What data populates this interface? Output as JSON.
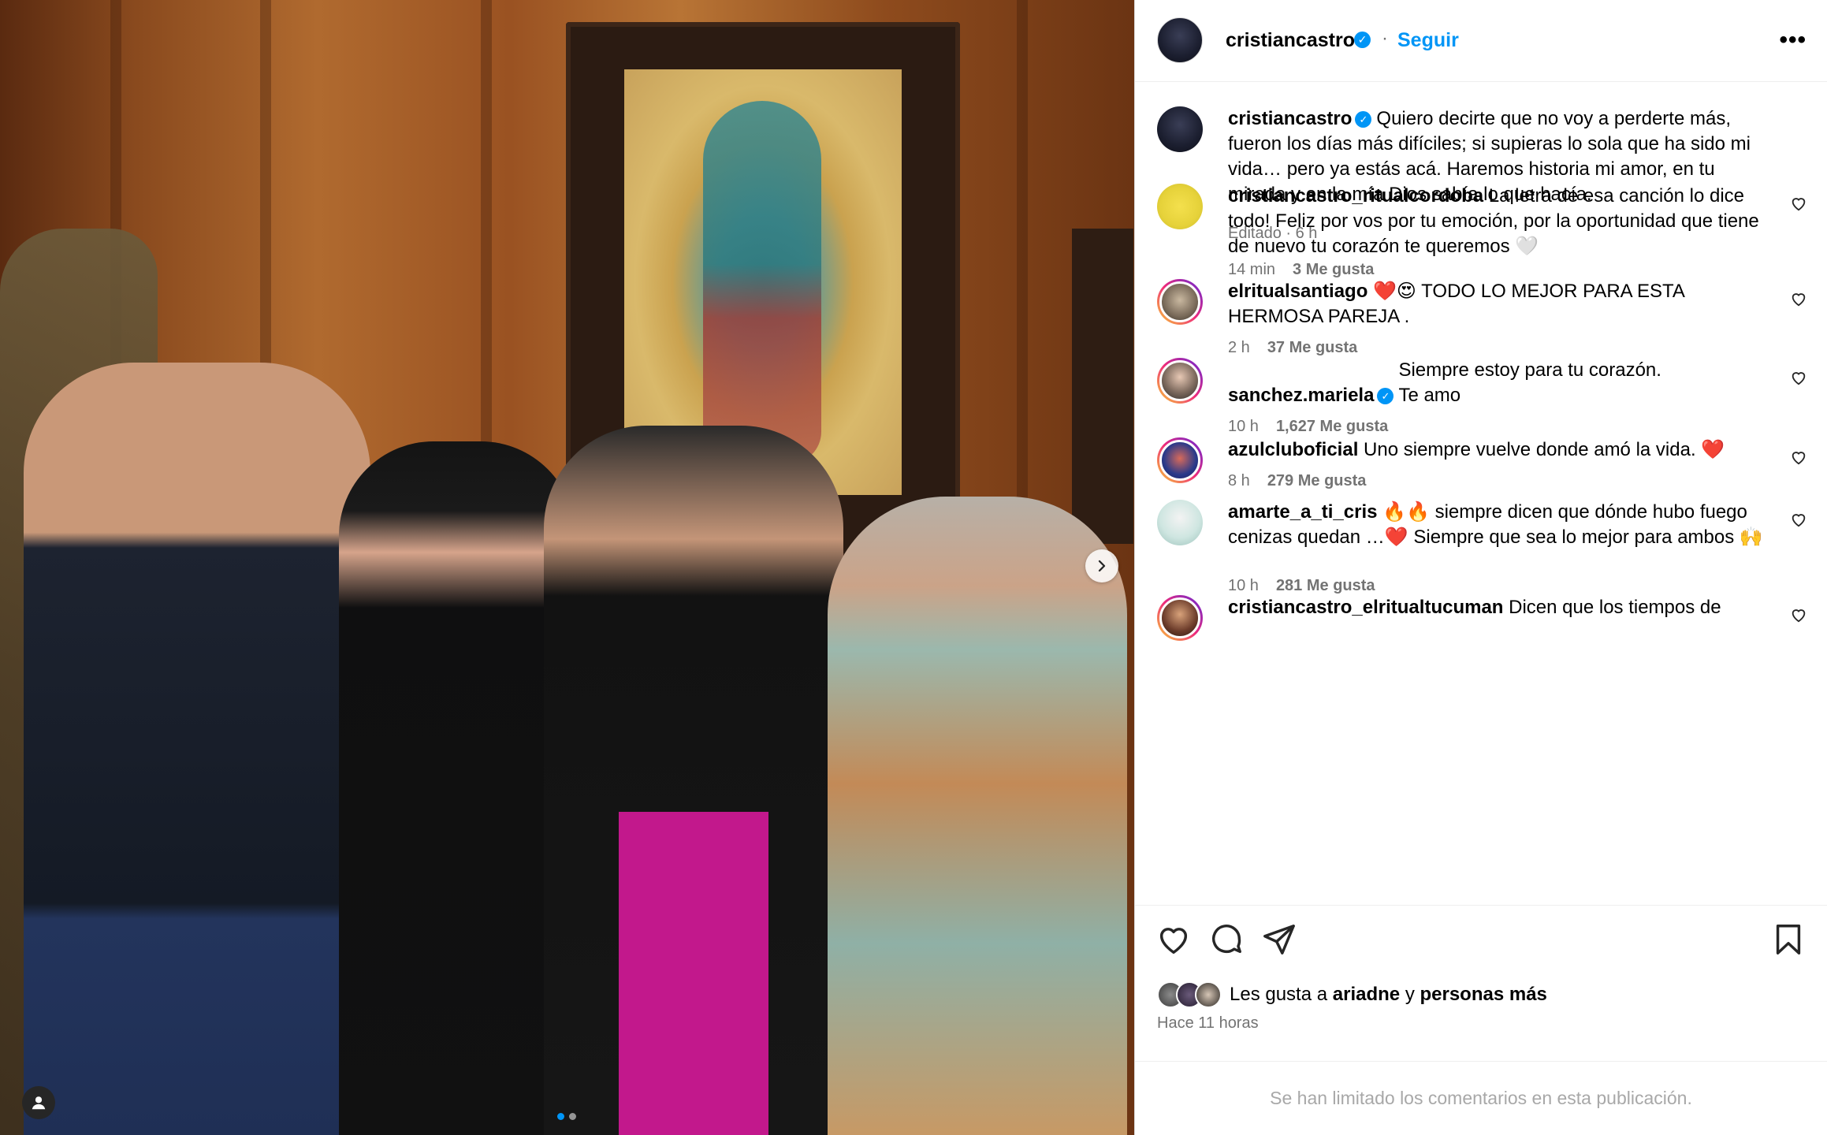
{
  "post": {
    "username": "cristiancastro",
    "follow_label": "Seguir",
    "separator": "·",
    "more_label": "•••",
    "caption": {
      "username": "cristiancastro",
      "text": "Quiero decirte que no voy a perderte más, fueron los días más difíciles; si supieras lo sola que ha sido mi vida… pero ya estás acá. Haremos historia mi amor, en tu mirada y en la mía Dios sabía lo que hacía.",
      "meta": "Editado · 6 h"
    },
    "media": {
      "slide_count": 2,
      "current_slide": 1
    }
  },
  "comments": [
    {
      "username": "cristiancastro_ritualcordoba",
      "verified": false,
      "text": "La letra de esa canción lo dice todo! Feliz por vos por tu emoción, por la oportunidad que tiene de nuevo tu corazón te queremos 🤍",
      "time": "14 min",
      "likes": "3 Me gusta"
    },
    {
      "username": "elritualsantiago",
      "verified": false,
      "text": "❤️😍 TODO LO MEJOR PARA ESTA HERMOSA PAREJA .",
      "time": "2 h",
      "likes": "37 Me gusta"
    },
    {
      "username": "sanchez.mariela",
      "verified": true,
      "text": "Siempre estoy para tu corazón. Te amo",
      "time": "10 h",
      "likes": "1,627 Me gusta"
    },
    {
      "username": "azulcluboficial",
      "verified": false,
      "text": "Uno siempre vuelve donde amó la vida. ❤️",
      "time": "8 h",
      "likes": "279 Me gusta"
    },
    {
      "username": "amarte_a_ti_cris",
      "verified": false,
      "text": "🔥🔥 siempre dicen que dónde hubo fuego cenizas quedan …❤️ Siempre que sea lo mejor para ambos 🙌",
      "time": "10 h",
      "likes": "281 Me gusta"
    },
    {
      "username": "cristiancastro_elritualtucuman",
      "verified": false,
      "text": "Dicen que los tiempos de",
      "time": "",
      "likes": ""
    }
  ],
  "likes_line": {
    "prefix": "Les gusta a",
    "user": "ariadne",
    "conj": "y",
    "rest": "personas más"
  },
  "posted_time": "Hace 11 horas",
  "footer_note": "Se han limitado los comentarios en esta publicación.",
  "colors": {
    "accent": "#0095f6",
    "muted": "#737373"
  },
  "icons": [
    "heart-icon",
    "comment-icon",
    "share-icon",
    "bookmark-icon",
    "more-icon",
    "user-tag-icon",
    "chevron-right-icon",
    "verified-icon"
  ]
}
